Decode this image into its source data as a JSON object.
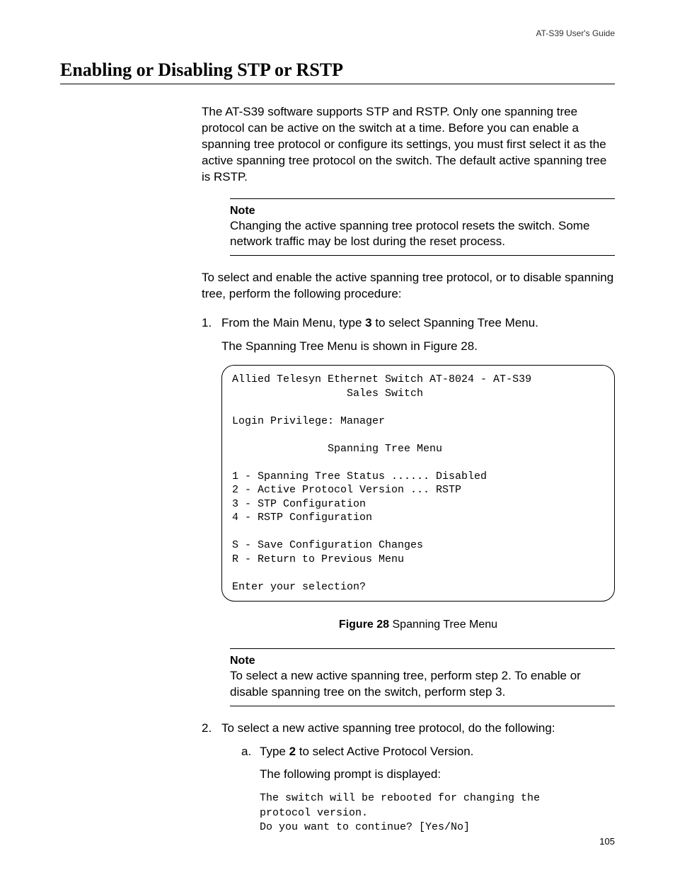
{
  "header": {
    "guide": "AT-S39 User's Guide"
  },
  "title": "Enabling or Disabling STP or RSTP",
  "intro": "The AT-S39 software supports STP and RSTP. Only one spanning tree protocol can be active on the switch at a time. Before you can enable a spanning tree protocol or configure its settings, you must first select it as the active spanning tree protocol on the switch. The default active spanning tree is RSTP.",
  "note1": {
    "label": "Note",
    "body": "Changing the active spanning tree protocol resets the switch. Some network traffic may be lost during the reset process."
  },
  "intro2": "To select and enable the active spanning tree protocol, or to disable spanning tree, perform the following procedure:",
  "step1": {
    "num": "1.",
    "pre": "From the Main Menu, type ",
    "bold": "3",
    "post": " to select Spanning Tree Menu.",
    "result": "The Spanning Tree Menu is shown in Figure 28."
  },
  "terminal": {
    "line1": "Allied Telesyn Ethernet Switch AT-8024 - AT-S39",
    "line2": "                  Sales Switch",
    "blank1": "",
    "line3": "Login Privilege: Manager",
    "blank2": "",
    "line4": "               Spanning Tree Menu",
    "blank3": "",
    "line5": "1 - Spanning Tree Status ...... Disabled",
    "line6": "2 - Active Protocol Version ... RSTP",
    "line7": "3 - STP Configuration",
    "line8": "4 - RSTP Configuration",
    "blank4": "",
    "line9": "S - Save Configuration Changes",
    "line10": "R - Return to Previous Menu",
    "blank5": "",
    "line11": "Enter your selection?"
  },
  "figure": {
    "label": "Figure 28",
    "caption": "  Spanning Tree Menu"
  },
  "note2": {
    "label": "Note",
    "body": "To select a new active spanning tree, perform step 2. To enable or disable spanning tree on the switch, perform step 3."
  },
  "step2": {
    "num": "2.",
    "text": "To select a new active spanning tree protocol, do the following:",
    "a": {
      "num": "a.",
      "pre": "Type ",
      "bold": "2",
      "post": " to select Active Protocol Version.",
      "result": "The following prompt is displayed:"
    },
    "code": "The switch will be rebooted for changing the\nprotocol version.\nDo you want to continue? [Yes/No]"
  },
  "pagenum": "105"
}
